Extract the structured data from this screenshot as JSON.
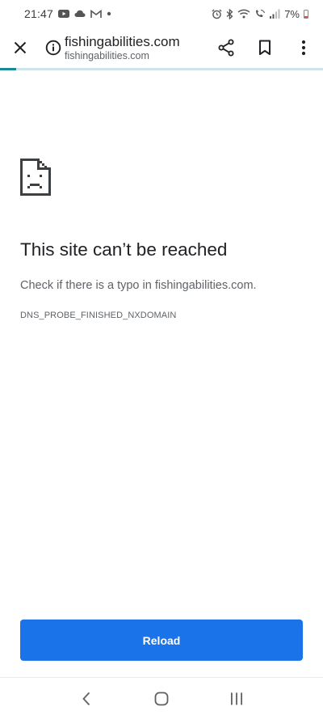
{
  "status_bar": {
    "time": "21:47",
    "battery": "7%",
    "icons_left": [
      "youtube-icon",
      "cloud-icon",
      "gmail-icon",
      "dot-icon"
    ],
    "icons_right": [
      "alarm-icon",
      "bluetooth-icon",
      "wifi-icon",
      "wifi-calling-icon",
      "signal-icon",
      "battery-icon"
    ]
  },
  "toolbar": {
    "title": "fishingabilities.com",
    "url": "fishingabilities.com",
    "actions": [
      "share-icon",
      "bookmark-icon",
      "more-icon"
    ]
  },
  "progress": {
    "fraction": 0.05,
    "track_color": "#cde5ea",
    "fill_color": "#1a8a9a"
  },
  "error": {
    "heading": "This site can’t be reached",
    "message": "Check if there is a typo in fishingabilities.com.",
    "code": "DNS_PROBE_FINISHED_NXDOMAIN"
  },
  "reload_button": {
    "label": "Reload",
    "color": "#1a73e8"
  },
  "nav_bar": {
    "buttons": [
      "back-icon",
      "home-icon",
      "recents-icon"
    ]
  }
}
